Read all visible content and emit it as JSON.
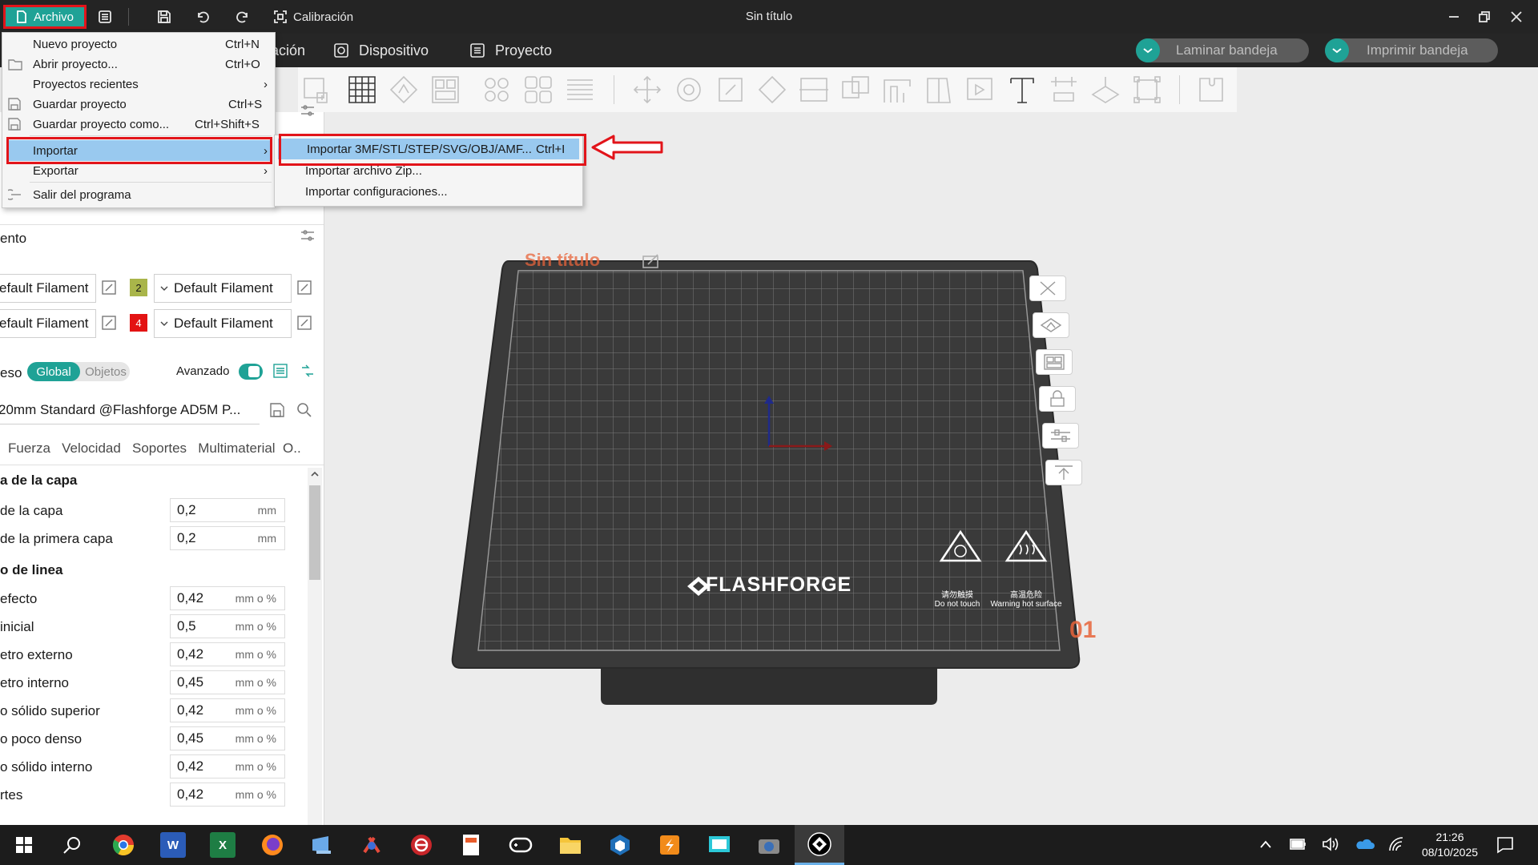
{
  "app": {
    "title": "Sin título",
    "archivo_label": "Archivo",
    "calibracion_label": "Calibración"
  },
  "tabs": {
    "preparacion_partial": "ación",
    "dispositivo": "Dispositivo",
    "proyecto": "Proyecto"
  },
  "actions": {
    "laminar": "Laminar bandeja",
    "imprimir": "Imprimir bandeja"
  },
  "file_menu": {
    "items": [
      {
        "label": "Nuevo proyecto",
        "shortcut": "Ctrl+N"
      },
      {
        "label": "Abrir proyecto...",
        "shortcut": "Ctrl+O"
      },
      {
        "label": "Proyectos recientes",
        "shortcut": "›"
      },
      {
        "label": "Guardar proyecto",
        "shortcut": "Ctrl+S"
      },
      {
        "label": "Guardar proyecto como...",
        "shortcut": "Ctrl+Shift+S"
      },
      {
        "label": "Importar",
        "shortcut": "›"
      },
      {
        "label": "Exportar",
        "shortcut": "›"
      },
      {
        "label": "Salir del programa",
        "shortcut": ""
      }
    ]
  },
  "import_submenu": {
    "items": [
      {
        "label": "Importar 3MF/STL/STEP/SVG/OBJ/AMF...",
        "shortcut": "Ctrl+I"
      },
      {
        "label": "Importar archivo Zip...",
        "shortcut": ""
      },
      {
        "label": "Importar configuraciones...",
        "shortcut": ""
      }
    ]
  },
  "left_panel": {
    "filament_header": "ento",
    "filaments": [
      {
        "left": "efault Filament",
        "num": "2",
        "right": "Default Filament",
        "color": "#a9b54a"
      },
      {
        "left": "efault Filament",
        "num": "4",
        "right": "Default Filament",
        "color": "#e31313"
      }
    ],
    "process_label": "eso",
    "global_label": "Global",
    "objetos_label": "Objetos",
    "avanzado_label": "Avanzado",
    "profile": "20mm Standard @Flashforge AD5M P...",
    "subtabs": [
      "Fuerza",
      "Velocidad",
      "Soportes",
      "Multimaterial",
      "O.."
    ],
    "section_capa": "a de la capa",
    "capa_rows": [
      {
        "label": "de la capa",
        "value": "0,2",
        "unit": "mm"
      },
      {
        "label": "de la primera capa",
        "value": "0,2",
        "unit": "mm"
      }
    ],
    "section_linea": "o de linea",
    "linea_rows": [
      {
        "label": "efecto",
        "value": "0,42",
        "unit": "mm o %"
      },
      {
        "label": "inicial",
        "value": "0,5",
        "unit": "mm o %"
      },
      {
        "label": "etro externo",
        "value": "0,42",
        "unit": "mm o %"
      },
      {
        "label": "etro interno",
        "value": "0,45",
        "unit": "mm o %"
      },
      {
        "label": "o sólido superior",
        "value": "0,42",
        "unit": "mm o %"
      },
      {
        "label": "o poco denso",
        "value": "0,45",
        "unit": "mm o %"
      },
      {
        "label": "o sólido interno",
        "value": "0,42",
        "unit": "mm o %"
      },
      {
        "label": "rtes",
        "value": "0,42",
        "unit": "mm o %"
      }
    ]
  },
  "plate": {
    "name": "Sin título",
    "brand": "FLASHFORGE",
    "number": "01",
    "warn1_cn": "请勿触摸",
    "warn1_en": "Do not touch",
    "warn2_cn": "高温危险",
    "warn2_en": "Warning hot surface"
  },
  "taskbar": {
    "time": "21:26",
    "date": "08/10/2025"
  },
  "colors": {
    "accent": "#1fa296",
    "highlight": "#e2141a"
  }
}
